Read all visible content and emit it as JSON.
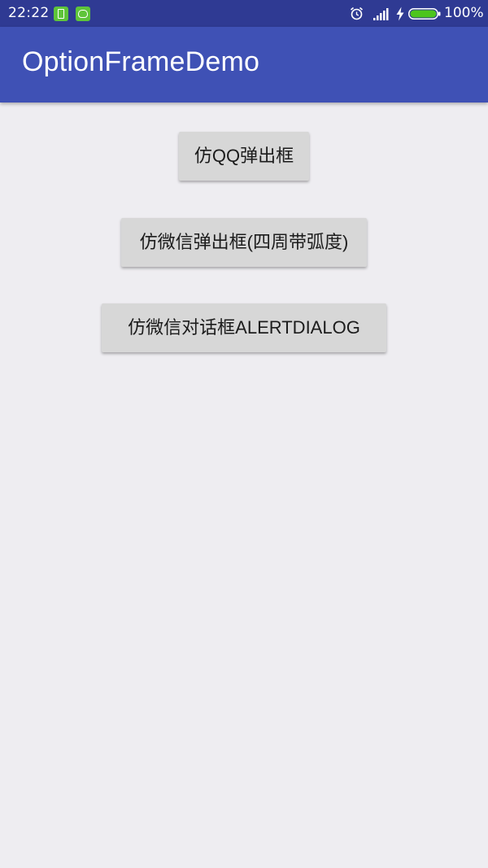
{
  "status_bar": {
    "time": "22:22",
    "battery_percent": "100%",
    "battery_level": 1.0,
    "notification_icons": [
      "sim-card-icon",
      "android-robot-icon"
    ],
    "system_icons": [
      "alarm-clock-icon",
      "signal-strength-icon",
      "charging-bolt-icon",
      "battery-icon"
    ],
    "colors": {
      "background": "#2f3a93",
      "notification_icon": "#5ec43a",
      "battery_fill": "#4cc51e"
    }
  },
  "app_bar": {
    "title": "OptionFrameDemo",
    "color": "#3f51b5"
  },
  "main": {
    "background": "#eeedf1",
    "buttons": [
      {
        "label": "仿QQ弹出框"
      },
      {
        "label": "仿微信弹出框(四周带弧度)"
      },
      {
        "label": "仿微信对话框ALERTDIALOG"
      }
    ]
  }
}
